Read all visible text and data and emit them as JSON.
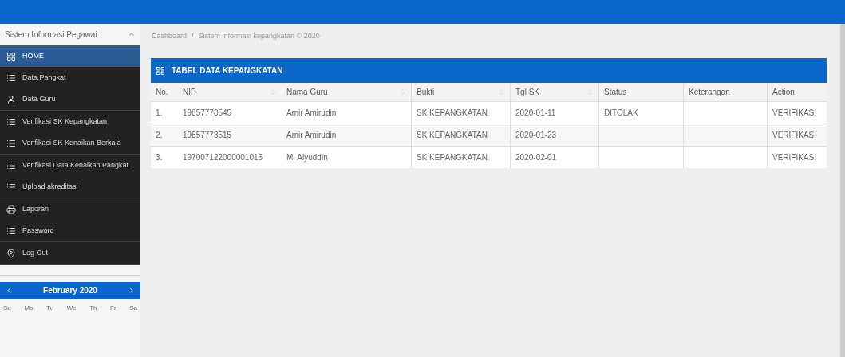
{
  "sidebar": {
    "title": "Sistem Informasi Pegawai",
    "menu_groups": [
      [
        {
          "label": "HOME",
          "kind": "grid",
          "selected": true
        },
        {
          "label": "Data Pangkat",
          "kind": "list",
          "selected": false
        },
        {
          "label": "Data Guru",
          "kind": "user",
          "selected": false
        }
      ],
      [
        {
          "label": "Verifikasi SK Kepangkatan",
          "kind": "list",
          "selected": false
        },
        {
          "label": "Verifikasi SK Kenaikan Berkala",
          "kind": "list",
          "selected": false
        }
      ],
      [
        {
          "label": "Verifikasi Data Kenaikan Pangkat",
          "kind": "list",
          "selected": false
        },
        {
          "label": "Upload akreditasi",
          "kind": "list",
          "selected": false
        }
      ],
      [
        {
          "label": "Laporan",
          "kind": "printer",
          "selected": false
        },
        {
          "label": "Password",
          "kind": "list",
          "selected": false
        }
      ],
      [
        {
          "label": "Log Out",
          "kind": "pin",
          "selected": false
        }
      ]
    ],
    "calendar": {
      "month": "February 2020",
      "weekdays": [
        "Su",
        "Mo",
        "Tu",
        "We",
        "Th",
        "Fr",
        "Sa"
      ]
    }
  },
  "breadcrumb": {
    "separator": "/",
    "items": [
      "Dashboard",
      "Sistem informasi kepangkatan © 2020"
    ]
  },
  "table": {
    "title": "TABEL DATA KEPANGKATAN",
    "columns": [
      {
        "label": "No.",
        "sortable": false
      },
      {
        "label": "NIP",
        "sortable": true
      },
      {
        "label": "Nama Guru",
        "sortable": true
      },
      {
        "label": "Bukti",
        "sortable": true
      },
      {
        "label": "Tgl SK",
        "sortable": true
      },
      {
        "label": "Status",
        "sortable": false
      },
      {
        "label": "Keterangan",
        "sortable": false
      },
      {
        "label": "Action",
        "sortable": false
      }
    ],
    "rows": [
      [
        "1.",
        "19857778545",
        "Amir Amirudin",
        "SK KEPANGKATAN",
        "2020-01-11",
        "DITOLAK",
        "",
        "VERIFIKASI"
      ],
      [
        "2.",
        "19857778515",
        "Amir Amirudin",
        "SK KEPANGKATAN",
        "2020-01-23",
        "",
        "",
        "VERIFIKASI"
      ],
      [
        "3.",
        "197007122000001015",
        "M. Alyuddin",
        "SK KEPANGKATAN",
        "2020-02-01",
        "",
        "",
        "VERIFIKASI"
      ]
    ]
  }
}
